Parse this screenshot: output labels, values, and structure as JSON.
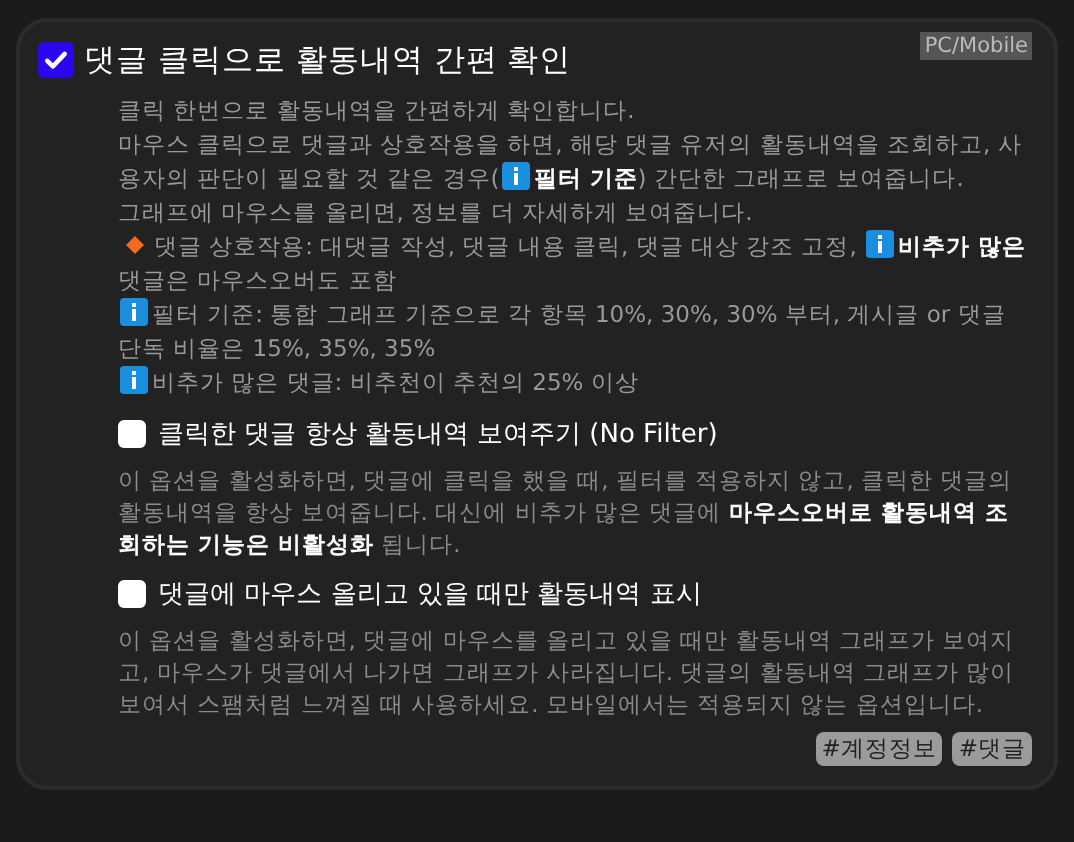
{
  "main_option": {
    "label": "댓글 클릭으로 활동내역 간편 확인",
    "checked": true,
    "badge": "PC/Mobile"
  },
  "description": [
    {
      "parts": [
        {
          "kind": "text",
          "text": "클릭 한번으로 활동내역을 간편하게 확인합니다."
        }
      ]
    },
    {
      "parts": [
        {
          "kind": "text",
          "text": "마우스 클릭으로 댓글과 상호작용을 하면, 해당 댓글 유저의 활동내역을 조회하고, 사용자의 판단이 필요할 것 같은 경우("
        },
        {
          "kind": "info"
        },
        {
          "kind": "text",
          "text": "**필터 기준**) 간단한 그래프로 보여줍니다."
        }
      ]
    },
    {
      "parts": [
        {
          "kind": "text",
          "text": "그래프에 마우스를 올리면, 정보를 더 자세하게 보여줍니다."
        }
      ]
    },
    {
      "parts": [
        {
          "kind": "bullet"
        },
        {
          "kind": "text",
          "text": "댓글 상호작용: 대댓글 작성, 댓글 내용 클릭, 댓글 대상 강조 고정, "
        },
        {
          "kind": "info"
        },
        {
          "kind": "text",
          "text": "**비추가 많은** 댓글은 마우스오버도 포함"
        }
      ]
    },
    {
      "parts": [
        {
          "kind": "info"
        },
        {
          "kind": "text",
          "text": "필터 기준: 통합 그래프 기준으로 각 항목 10%, 30%, 30% 부터, 게시글 or 댓글 단독 비율은 15%, 35%, 35%"
        }
      ]
    },
    {
      "parts": [
        {
          "kind": "info"
        },
        {
          "kind": "text",
          "text": "비추가 많은 댓글: 비추천이 추천의 25% 이상"
        }
      ]
    }
  ],
  "sub_options": [
    {
      "label": "클릭한 댓글 항상 활동내역 보여주기 (No Filter)",
      "checked": false,
      "description": "이 옵션을 활성화하면, 댓글에 클릭을 했을 때, 필터를 적용하지 않고, 클릭한 댓글의 활동내역을 항상 보여줍니다. 대신에 비추가 많은 댓글에 **마우스오버로 활동내역 조회하는 기능은 비활성화** 됩니다."
    },
    {
      "label": "댓글에 마우스 올리고 있을 때만 활동내역 표시",
      "checked": false,
      "description": "이 옵션을 활성화하면, 댓글에 마우스를 올리고 있을 때만 활동내역 그래프가 보여지고, 마우스가 댓글에서 나가면 그래프가 사라집니다. 댓글의 활동내역 그래프가 많이 보여서 스팸처럼 느껴질 때 사용하세요. 모바일에서는 적용되지 않는 옵션입니다."
    }
  ],
  "tags": [
    "#계정정보",
    "#댓글"
  ]
}
